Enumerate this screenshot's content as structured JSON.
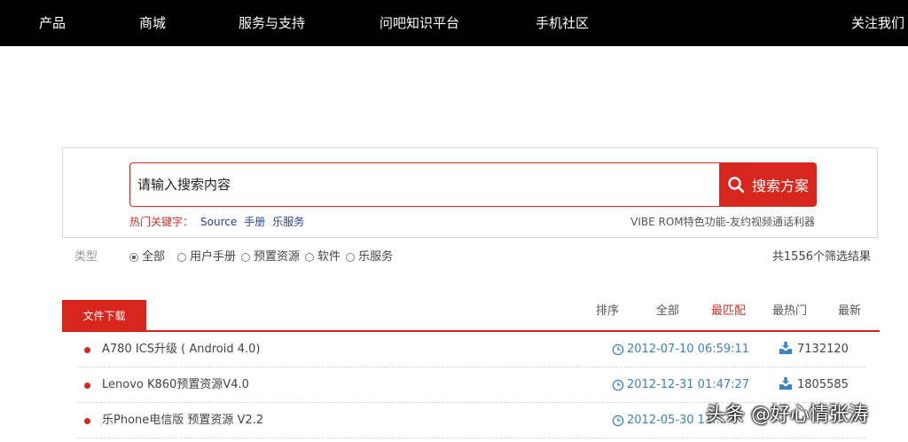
{
  "nav": {
    "items": [
      "产品",
      "商城",
      "服务与支持",
      "问吧知识平台",
      "手机社区"
    ],
    "follow": "关注我们"
  },
  "search": {
    "placeholder": "请输入搜索内容",
    "value": "",
    "button_label": "搜索方案",
    "button_icon": "search-icon",
    "hot_label": "热门关键字：",
    "hot_keywords": [
      "Source",
      "手册",
      "乐服务"
    ],
    "promo": "VIBE ROM特色功能-友约视频通话利器"
  },
  "filter": {
    "label": "类型",
    "options": [
      "全部",
      "用户手册",
      "预置资源",
      "软件",
      "乐服务"
    ],
    "selected": "全部",
    "result_count": "共1556个筛选结果"
  },
  "tabs": {
    "active": "文件下载"
  },
  "sort": {
    "label": "排序",
    "options": [
      "全部",
      "最匹配",
      "最热门",
      "最新"
    ],
    "active": "最匹配"
  },
  "files": [
    {
      "name": "A780 ICS升级 ( Android 4.0)",
      "date": "2012-07-10 06:59:11",
      "downloads": "7132120"
    },
    {
      "name": "Lenovo K860预置资源V4.0",
      "date": "2012-12-31 01:47:27",
      "downloads": "1805585"
    },
    {
      "name": "乐Phone电信版 预置资源 V2.2",
      "date": "2012-05-30 11:...",
      "downloads": ""
    }
  ],
  "watermark": "头条 @好心情张涛",
  "colors": {
    "accent": "#d6261d",
    "nav_bg": "#000000",
    "date_blue": "#3b82c4",
    "keyword_blue": "#2a3f9a"
  }
}
